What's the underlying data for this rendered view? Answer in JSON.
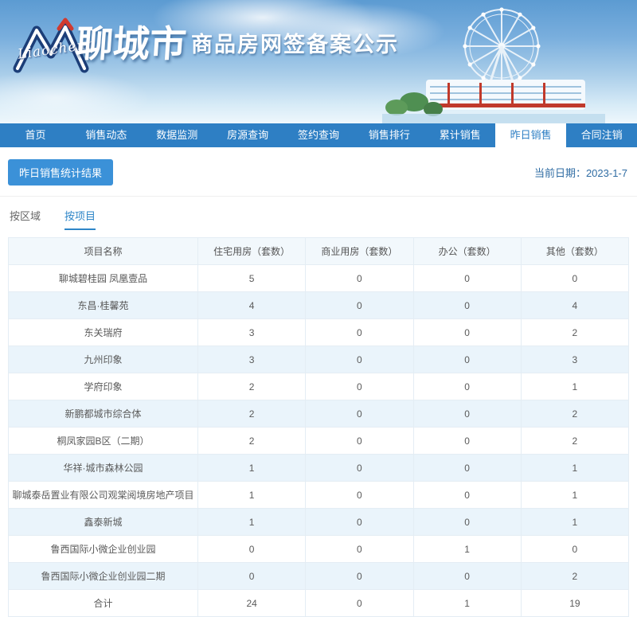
{
  "header": {
    "logo_text": "Liaocheng",
    "city_title": "聊城市",
    "site_title": "商品房网签备案公示"
  },
  "nav": {
    "items": [
      {
        "key": "home",
        "label": "首页",
        "active": false
      },
      {
        "key": "sales-news",
        "label": "销售动态",
        "active": false
      },
      {
        "key": "data-monitor",
        "label": "数据监测",
        "active": false
      },
      {
        "key": "listing-query",
        "label": "房源查询",
        "active": false
      },
      {
        "key": "signing-query",
        "label": "签约查询",
        "active": false
      },
      {
        "key": "sales-rank",
        "label": "销售排行",
        "active": false
      },
      {
        "key": "total-sales",
        "label": "累计销售",
        "active": false
      },
      {
        "key": "yesterday-sales",
        "label": "昨日销售",
        "active": true
      },
      {
        "key": "contract-cancel",
        "label": "合同注销",
        "active": false
      }
    ]
  },
  "page": {
    "section_title": "昨日销售统计结果",
    "date_label": "当前日期：2023-1-7",
    "tabs": [
      {
        "key": "by-region",
        "label": "按区域",
        "active": false
      },
      {
        "key": "by-project",
        "label": "按项目",
        "active": true
      }
    ]
  },
  "table": {
    "headers": [
      "项目名称",
      "住宅用房（套数）",
      "商业用房（套数）",
      "办公（套数）",
      "其他（套数）"
    ],
    "rows": [
      {
        "name": "聊城碧桂园 凤凰壹品",
        "values": [
          5,
          0,
          0,
          0
        ]
      },
      {
        "name": "东昌·桂馨苑",
        "values": [
          4,
          0,
          0,
          4
        ]
      },
      {
        "name": "东关瑞府",
        "values": [
          3,
          0,
          0,
          2
        ]
      },
      {
        "name": "九州印象",
        "values": [
          3,
          0,
          0,
          3
        ]
      },
      {
        "name": "学府印象",
        "values": [
          2,
          0,
          0,
          1
        ]
      },
      {
        "name": "新鹏都城市综合体",
        "values": [
          2,
          0,
          0,
          2
        ]
      },
      {
        "name": "桐凤家园B区（二期）",
        "values": [
          2,
          0,
          0,
          2
        ]
      },
      {
        "name": "华祥·城市森林公园",
        "values": [
          1,
          0,
          0,
          1
        ]
      },
      {
        "name": "聊城泰岳置业有限公司观棠阅境房地产项目",
        "values": [
          1,
          0,
          0,
          1
        ]
      },
      {
        "name": "鑫泰新城",
        "values": [
          1,
          0,
          0,
          1
        ]
      },
      {
        "name": "鲁西国际小微企业创业园",
        "values": [
          0,
          0,
          1,
          0
        ]
      },
      {
        "name": "鲁西国际小微企业创业园二期",
        "values": [
          0,
          0,
          0,
          2
        ]
      }
    ],
    "total": {
      "name": "合计",
      "values": [
        24,
        0,
        1,
        19
      ]
    }
  },
  "colors": {
    "nav_blue": "#2e7fc4",
    "badge_blue": "#3b91d8",
    "active_tab_blue": "#2e86c8",
    "alt_row_blue": "#eaf4fb",
    "header_row_bg": "#f2f8fc",
    "table_border": "#e4edf4",
    "date_text": "#2f6ca3"
  }
}
